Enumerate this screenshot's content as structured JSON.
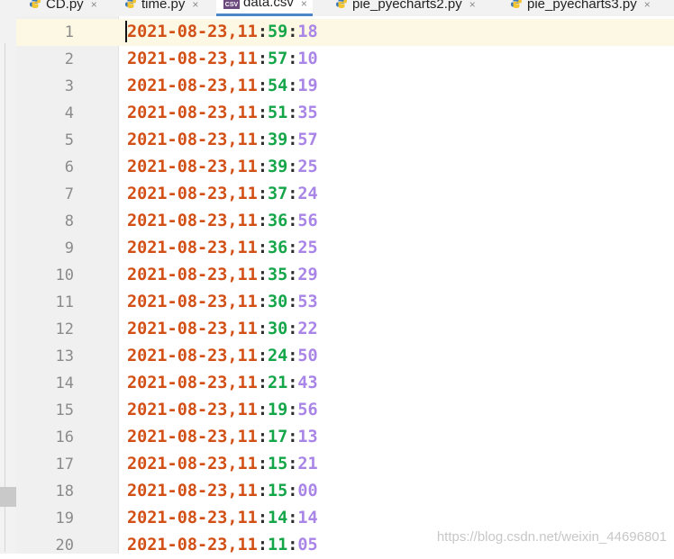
{
  "tabs": [
    {
      "label": "CD.py",
      "icon": "python-file-icon",
      "active": false
    },
    {
      "label": "time.py",
      "icon": "python-file-icon",
      "active": false
    },
    {
      "label": "data.csv",
      "icon": "csv-file-icon",
      "active": true
    },
    {
      "label": "pie_pyecharts2.py",
      "icon": "python-file-icon",
      "active": false
    },
    {
      "label": "pie_pyecharts3.py",
      "icon": "python-file-icon",
      "active": false
    }
  ],
  "csv_icon_text": "CSV",
  "close_glyph": "×",
  "lines": [
    {
      "n": "1",
      "date": "2021-08-23",
      "hour": "11",
      "min": "59",
      "sec": "18"
    },
    {
      "n": "2",
      "date": "2021-08-23",
      "hour": "11",
      "min": "57",
      "sec": "10"
    },
    {
      "n": "3",
      "date": "2021-08-23",
      "hour": "11",
      "min": "54",
      "sec": "19"
    },
    {
      "n": "4",
      "date": "2021-08-23",
      "hour": "11",
      "min": "51",
      "sec": "35"
    },
    {
      "n": "5",
      "date": "2021-08-23",
      "hour": "11",
      "min": "39",
      "sec": "57"
    },
    {
      "n": "6",
      "date": "2021-08-23",
      "hour": "11",
      "min": "39",
      "sec": "25"
    },
    {
      "n": "7",
      "date": "2021-08-23",
      "hour": "11",
      "min": "37",
      "sec": "24"
    },
    {
      "n": "8",
      "date": "2021-08-23",
      "hour": "11",
      "min": "36",
      "sec": "56"
    },
    {
      "n": "9",
      "date": "2021-08-23",
      "hour": "11",
      "min": "36",
      "sec": "25"
    },
    {
      "n": "10",
      "date": "2021-08-23",
      "hour": "11",
      "min": "35",
      "sec": "29"
    },
    {
      "n": "11",
      "date": "2021-08-23",
      "hour": "11",
      "min": "30",
      "sec": "53"
    },
    {
      "n": "12",
      "date": "2021-08-23",
      "hour": "11",
      "min": "30",
      "sec": "22"
    },
    {
      "n": "13",
      "date": "2021-08-23",
      "hour": "11",
      "min": "24",
      "sec": "50"
    },
    {
      "n": "14",
      "date": "2021-08-23",
      "hour": "11",
      "min": "21",
      "sec": "43"
    },
    {
      "n": "15",
      "date": "2021-08-23",
      "hour": "11",
      "min": "19",
      "sec": "56"
    },
    {
      "n": "16",
      "date": "2021-08-23",
      "hour": "11",
      "min": "17",
      "sec": "13"
    },
    {
      "n": "17",
      "date": "2021-08-23",
      "hour": "11",
      "min": "15",
      "sec": "21"
    },
    {
      "n": "18",
      "date": "2021-08-23",
      "hour": "11",
      "min": "15",
      "sec": "00"
    },
    {
      "n": "19",
      "date": "2021-08-23",
      "hour": "11",
      "min": "14",
      "sec": "14"
    },
    {
      "n": "20",
      "date": "2021-08-23",
      "hour": "11",
      "min": "11",
      "sec": "05"
    }
  ],
  "watermark": "https://blog.csdn.net/weixin_44696801",
  "colors": {
    "date": "#d24f16",
    "minute": "#16a64a",
    "second": "#a885e6",
    "separator": "#2b2b2b",
    "current_line": "#fdf8e3",
    "active_tab_underline": "#4a86c8"
  }
}
